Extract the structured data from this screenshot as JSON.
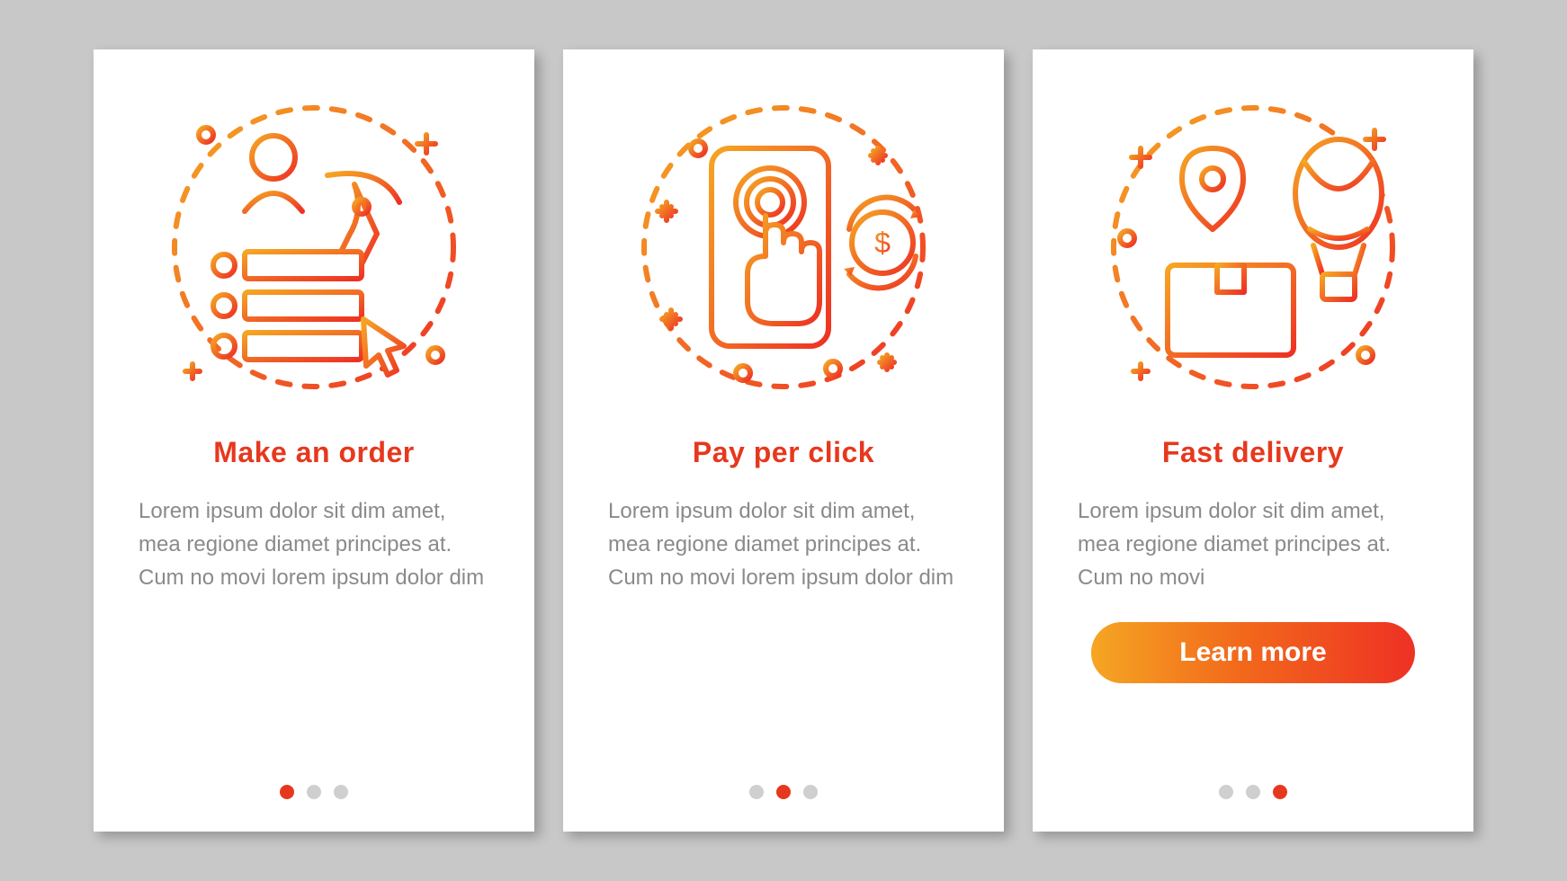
{
  "colors": {
    "accent_red": "#e6381e",
    "accent_orange": "#f5a623",
    "text_gray": "#8a8a8a",
    "bg_gray": "#c8c8c8",
    "dot_inactive": "#cfcfcf"
  },
  "screens": [
    {
      "illustration_name": "make-order-illustration",
      "title": "Make an order",
      "body": "Lorem ipsum dolor sit dim amet, mea regione diamet principes at. Cum no movi lorem ipsum dolor dim",
      "active_dot_index": 0,
      "dot_count": 3,
      "cta": null
    },
    {
      "illustration_name": "pay-per-click-illustration",
      "title": "Pay per click",
      "body": "Lorem ipsum dolor sit dim amet, mea regione diamet principes at. Cum no movi lorem ipsum dolor dim",
      "active_dot_index": 1,
      "dot_count": 3,
      "cta": null
    },
    {
      "illustration_name": "fast-delivery-illustration",
      "title": "Fast delivery",
      "body": "Lorem ipsum dolor sit dim amet, mea regione diamet principes at. Cum no movi",
      "active_dot_index": 2,
      "dot_count": 3,
      "cta": {
        "label": "Learn more"
      }
    }
  ]
}
